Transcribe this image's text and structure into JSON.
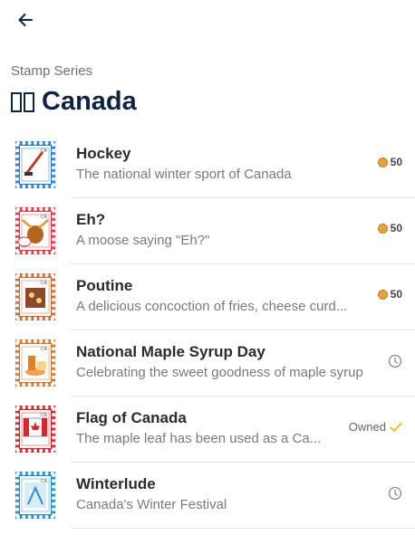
{
  "header": {
    "back_icon": "arrow-left-icon"
  },
  "page": {
    "subtitle": "Stamp Series",
    "title": "Canada",
    "title_flag_glyph": "flag-icon"
  },
  "colors": {
    "title": "#0f2440",
    "coin": "#e9a23b",
    "owned_check": "#f2c230",
    "divider": "#e4e4e4"
  },
  "stamps": [
    {
      "name": "Hockey",
      "description": "The national winter sport of Canada",
      "status": "price",
      "price": "50",
      "icon": "hockey-stamp-icon",
      "stamp_color": "#2f7fd1"
    },
    {
      "name": "Eh?",
      "description": "A moose saying \"Eh?\"",
      "status": "price",
      "price": "50",
      "icon": "moose-stamp-icon",
      "stamp_color": "#e23c47"
    },
    {
      "name": "Poutine",
      "description": "A delicious concoction of fries, cheese curd...",
      "status": "price",
      "price": "50",
      "icon": "poutine-stamp-icon",
      "stamp_color": "#c96d3a"
    },
    {
      "name": "National Maple Syrup Day",
      "description": "Celebrating the sweet goodness of maple syrup",
      "status": "pending",
      "icon": "maple-syrup-stamp-icon",
      "stamp_color": "#d07a3a"
    },
    {
      "name": "Flag of Canada",
      "description": "The maple leaf has been used as a Ca...",
      "status": "owned",
      "owned_label": "Owned",
      "icon": "flag-stamp-icon",
      "stamp_color": "#d8262d"
    },
    {
      "name": "Winterlude",
      "description": "Canada's Winter Festival",
      "status": "pending",
      "icon": "winterlude-stamp-icon",
      "stamp_color": "#2a8fc7"
    }
  ]
}
